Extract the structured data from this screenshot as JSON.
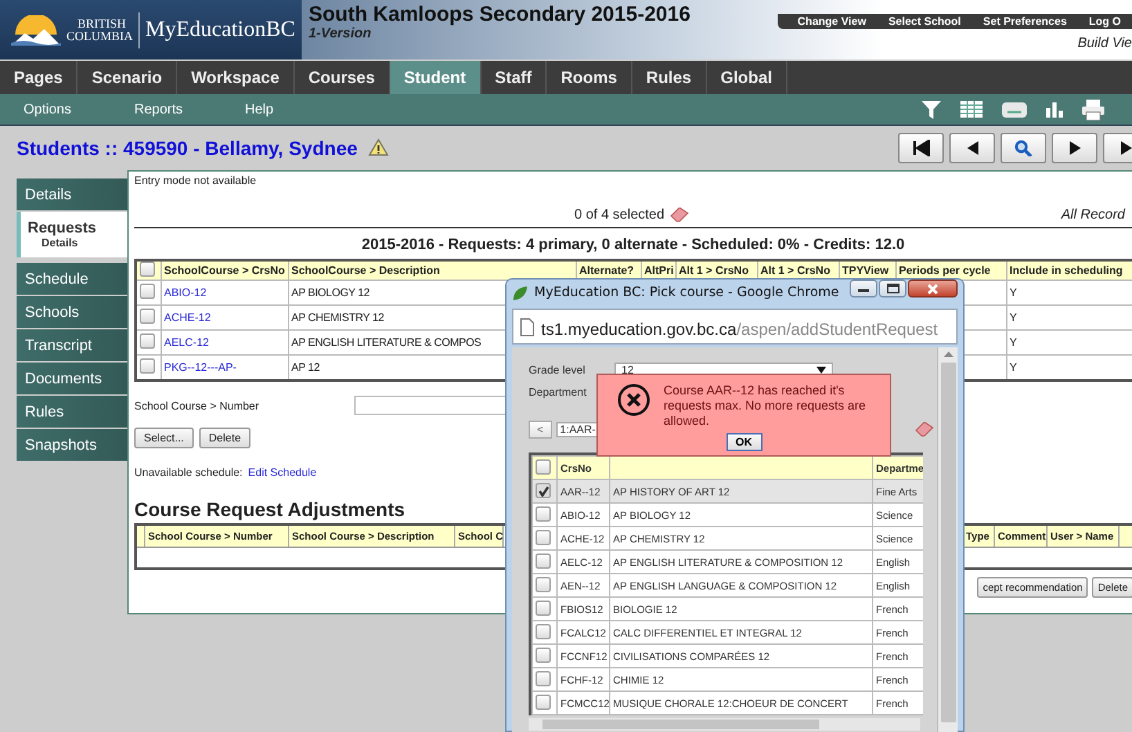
{
  "header": {
    "logo_line1": "BRITISH",
    "logo_line2": "COLUMBIA",
    "app_name": "MyEducationBC",
    "school": "South Kamloops Secondary 2015-2016",
    "version": "1-Version",
    "links": [
      "Change View",
      "Select School",
      "Set Preferences",
      "Log O"
    ],
    "build_view": "Build Vie"
  },
  "nav_tabs": [
    {
      "label": "Pages",
      "selected": false
    },
    {
      "label": "Scenario",
      "selected": false
    },
    {
      "label": "Workspace",
      "selected": false
    },
    {
      "label": "Courses",
      "selected": false
    },
    {
      "label": "Student",
      "selected": true
    },
    {
      "label": "Staff",
      "selected": false
    },
    {
      "label": "Rooms",
      "selected": false
    },
    {
      "label": "Rules",
      "selected": false
    },
    {
      "label": "Global",
      "selected": false
    }
  ],
  "sub_menu": [
    "Options",
    "Reports",
    "Help"
  ],
  "student_title": "Students :: 459590 - Bellamy, Sydnee",
  "side_tabs": [
    {
      "label": "Details",
      "selected": false
    },
    {
      "label": "Requests",
      "selected": true,
      "sub": "Details"
    },
    {
      "label": "Schedule",
      "selected": false
    },
    {
      "label": "Schools",
      "selected": false
    },
    {
      "label": "Transcript",
      "selected": false
    },
    {
      "label": "Documents",
      "selected": false
    },
    {
      "label": "Rules",
      "selected": false
    },
    {
      "label": "Snapshots",
      "selected": false
    }
  ],
  "panel": {
    "entry_mode": "Entry mode not available",
    "selection": "0 of 4 selected",
    "all_records": "All Record",
    "summary": "2015-2016 - Requests: 4 primary, 0 alternate - Scheduled: 0% - Credits: 12.0",
    "select_all_checked": false,
    "columns": [
      "SchoolCourse > CrsNo",
      "SchoolCourse > Description",
      "Alternate?",
      "AltPri",
      "Alt 1 > CrsNo",
      "Alt 1 > CrsNo",
      "TPYView",
      "Periods per cycle",
      "Include in scheduling"
    ],
    "rows": [
      {
        "crsno": "ABIO-12",
        "description": "AP BIOLOGY 12",
        "include": "Y",
        "checked": false
      },
      {
        "crsno": "ACHE-12",
        "description": "AP CHEMISTRY 12",
        "include": "Y",
        "checked": false
      },
      {
        "crsno": "AELC-12",
        "description": "AP ENGLISH LITERATURE & COMPOS",
        "include": "Y",
        "checked": false
      },
      {
        "crsno": "PKG--12---AP-",
        "description": "AP 12",
        "include": "Y",
        "checked": false
      }
    ],
    "number_label": "School Course > Number",
    "buttons": [
      "Select...",
      "Delete"
    ],
    "unavailable_label": "Unavailable schedule:",
    "edit_link": "Edit Schedule",
    "adjustments_title": "Course Request Adjustments",
    "adjustment_columns": [
      "School Course > Number",
      "School Course > Description",
      "School C",
      "Type",
      "Comment",
      "User > Name"
    ],
    "bottom_buttons": [
      "cept recommendation",
      "Delete"
    ]
  },
  "popup": {
    "title": "MyEducation BC: Pick course - Google Chrome",
    "url_host": "ts1.myeducation.gov.bc.ca",
    "url_path": "/aspen/addStudentRequest",
    "grade_label": "Grade level",
    "grade_value": "12",
    "department_label": "Department",
    "pager_prev": "<",
    "pager_value": "1:AAR-",
    "alert": {
      "message": "Course AAR--12 has reached it's requests max. No more requests are allowed.",
      "button": "OK"
    },
    "select_all_checked": false,
    "columns": [
      "CrsNo",
      "Departme"
    ],
    "rows": [
      {
        "crsno": "AAR--12",
        "description": "AP HISTORY OF ART 12",
        "department": "Fine Arts",
        "checked": true
      },
      {
        "crsno": "ABIO-12",
        "description": "AP BIOLOGY 12",
        "department": "Science",
        "checked": false
      },
      {
        "crsno": "ACHE-12",
        "description": "AP CHEMISTRY 12",
        "department": "Science",
        "checked": false
      },
      {
        "crsno": "AELC-12",
        "description": "AP ENGLISH LITERATURE & COMPOSITION 12",
        "department": "English",
        "checked": false
      },
      {
        "crsno": "AEN--12",
        "description": "AP ENGLISH LANGUAGE & COMPOSITION 12",
        "department": "English",
        "checked": false
      },
      {
        "crsno": "FBIOS12",
        "description": "BIOLOGIE 12",
        "department": "French",
        "checked": false
      },
      {
        "crsno": "FCALC12",
        "description": "CALC DIFFERENTIEL ET INTEGRAL 12",
        "department": "French",
        "checked": false
      },
      {
        "crsno": "FCCNF12",
        "description": "CIVILISATIONS COMPARÉES 12",
        "department": "French",
        "checked": false
      },
      {
        "crsno": "FCHF-12",
        "description": "CHIMIE 12",
        "department": "French",
        "checked": false
      },
      {
        "crsno": "FCMCC12",
        "description": "MUSIQUE CHORALE 12:CHOEUR DE CONCERT",
        "department": "French",
        "checked": false
      }
    ]
  }
}
